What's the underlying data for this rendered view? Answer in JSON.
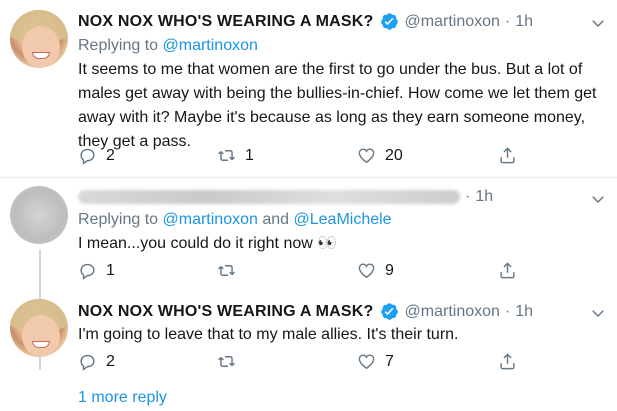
{
  "tweets": [
    {
      "author_name": "NOX NOX WHO'S WEARING A MASK?",
      "handle": "@martinoxon",
      "separator": "·",
      "time": "1h",
      "replying_label": "Replying to",
      "replying_to": "@martinoxon",
      "replying_joiner": "",
      "replying_to_2": "",
      "text": "It seems to me that women are the first to go under the bus. But a lot of males get away with being the bullies-in-chief. How come we let them get away with it? Maybe it's because as long as they earn someone money, they get a pass.",
      "reply_count": "2",
      "retweet_count": "1",
      "like_count": "20"
    },
    {
      "author_name": "",
      "handle": "",
      "separator": "·",
      "time": "1h",
      "replying_label": "Replying to",
      "replying_to": "@martinoxon",
      "replying_joiner": "and",
      "replying_to_2": "@LeaMichele",
      "text": "I mean...you could do it right now 👀",
      "reply_count": "1",
      "retweet_count": "",
      "like_count": "9"
    },
    {
      "author_name": "NOX NOX WHO'S WEARING A MASK?",
      "handle": "@martinoxon",
      "separator": "·",
      "time": "1h",
      "text": "I'm going to leave that to my male allies. It's their turn.",
      "reply_count": "2",
      "retweet_count": "",
      "like_count": "7"
    }
  ],
  "more_replies": "1 more reply",
  "colors": {
    "link": "#1b95e0",
    "secondary": "#657786",
    "verified": "#1da1f2",
    "divider": "#e6ecf0"
  },
  "icons": [
    "verified-badge-icon",
    "chevron-down-icon",
    "reply-icon",
    "retweet-icon",
    "like-icon",
    "share-icon"
  ]
}
